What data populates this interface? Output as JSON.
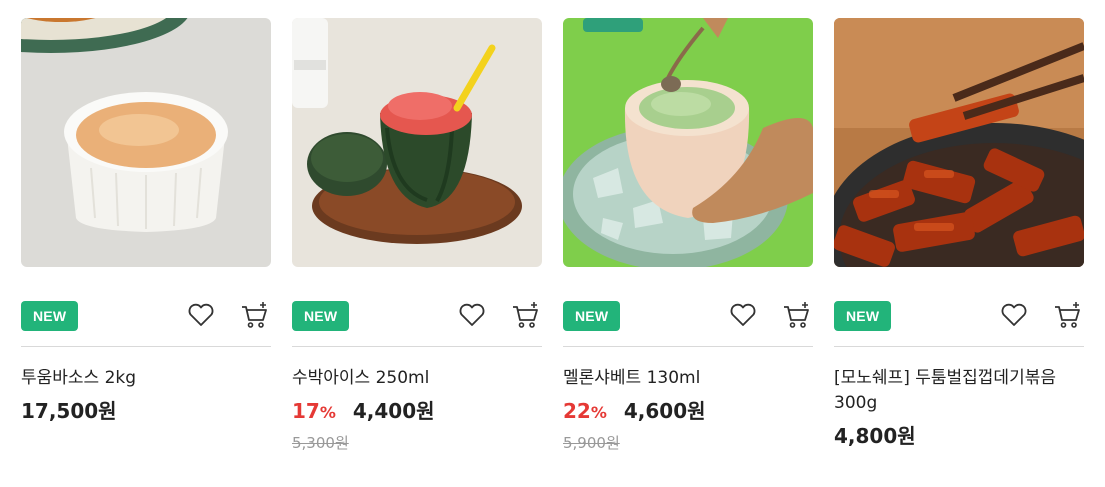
{
  "products": [
    {
      "badge": "NEW",
      "name": "투움바소스 2kg",
      "discount": "",
      "discount_unit": "",
      "price": "17,500원",
      "original_price": ""
    },
    {
      "badge": "NEW",
      "name": "수박아이스 250ml",
      "discount": "17",
      "discount_unit": "%",
      "price": "4,400원",
      "original_price": "5,300원"
    },
    {
      "badge": "NEW",
      "name": "멜론샤베트 130ml",
      "discount": "22",
      "discount_unit": "%",
      "price": "4,600원",
      "original_price": "5,900원"
    },
    {
      "badge": "NEW",
      "name": "[모노쉐프] 두툼벌집껍데기볶음 300g",
      "discount": "",
      "discount_unit": "",
      "price": "4,800원",
      "original_price": ""
    }
  ],
  "icons": {
    "wishlist": "heart-icon",
    "cart": "cart-icon"
  },
  "colors": {
    "badge": "#22b47a",
    "discount": "#e53935",
    "original_price": "#999999"
  }
}
